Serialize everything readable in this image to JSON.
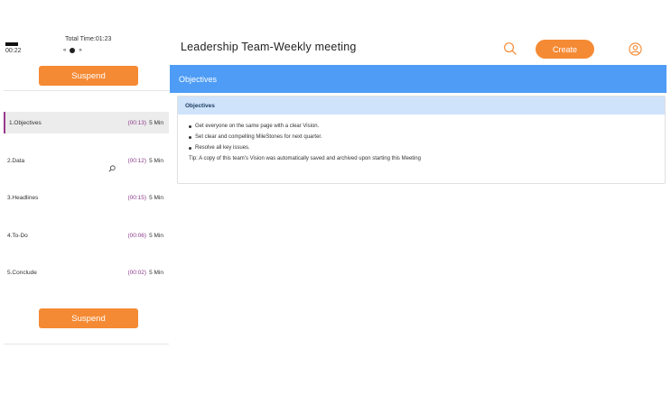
{
  "timer": {
    "elapsed": "00:22",
    "total": "Total Time:01:23",
    "controls": {
      "prev": "«",
      "next": "»"
    }
  },
  "sidebar": {
    "suspend_label": "Suspend",
    "items": [
      {
        "label": "1.Objectives",
        "time": "(00:13)",
        "duration": "5 Min"
      },
      {
        "label": "2.Data",
        "time": "(00:12)",
        "duration": "5 Min"
      },
      {
        "label": "3.Headlines",
        "time": "(00:15)",
        "duration": "5 Min"
      },
      {
        "label": "4.To-Do",
        "time": "(00:06)",
        "duration": "5 Min"
      },
      {
        "label": "5.Conclude",
        "time": "(00:02)",
        "duration": "5 Min"
      }
    ]
  },
  "header": {
    "title": "Leadership Team-Weekly meeting",
    "create_label": "Create"
  },
  "main": {
    "section_title": "Objectives",
    "card_title": "Objectives",
    "bullets": [
      "Get everyone on the same page with a clear Vision.",
      "Set clear and compelling MileStones for next quarter.",
      "Resolve all key issues."
    ],
    "tip": "Tip: A copy of this team's Vision was automatically saved and archived upon starting this Meeting"
  },
  "colors": {
    "accent_orange": "#f58a34",
    "header_blue": "#4e9cf5",
    "card_head_blue": "#cfe3fb",
    "time_purple": "#8a3a8a"
  },
  "icons": [
    "search-icon",
    "user-icon",
    "search-small-icon",
    "prev-icon",
    "play-icon",
    "next-icon"
  ]
}
